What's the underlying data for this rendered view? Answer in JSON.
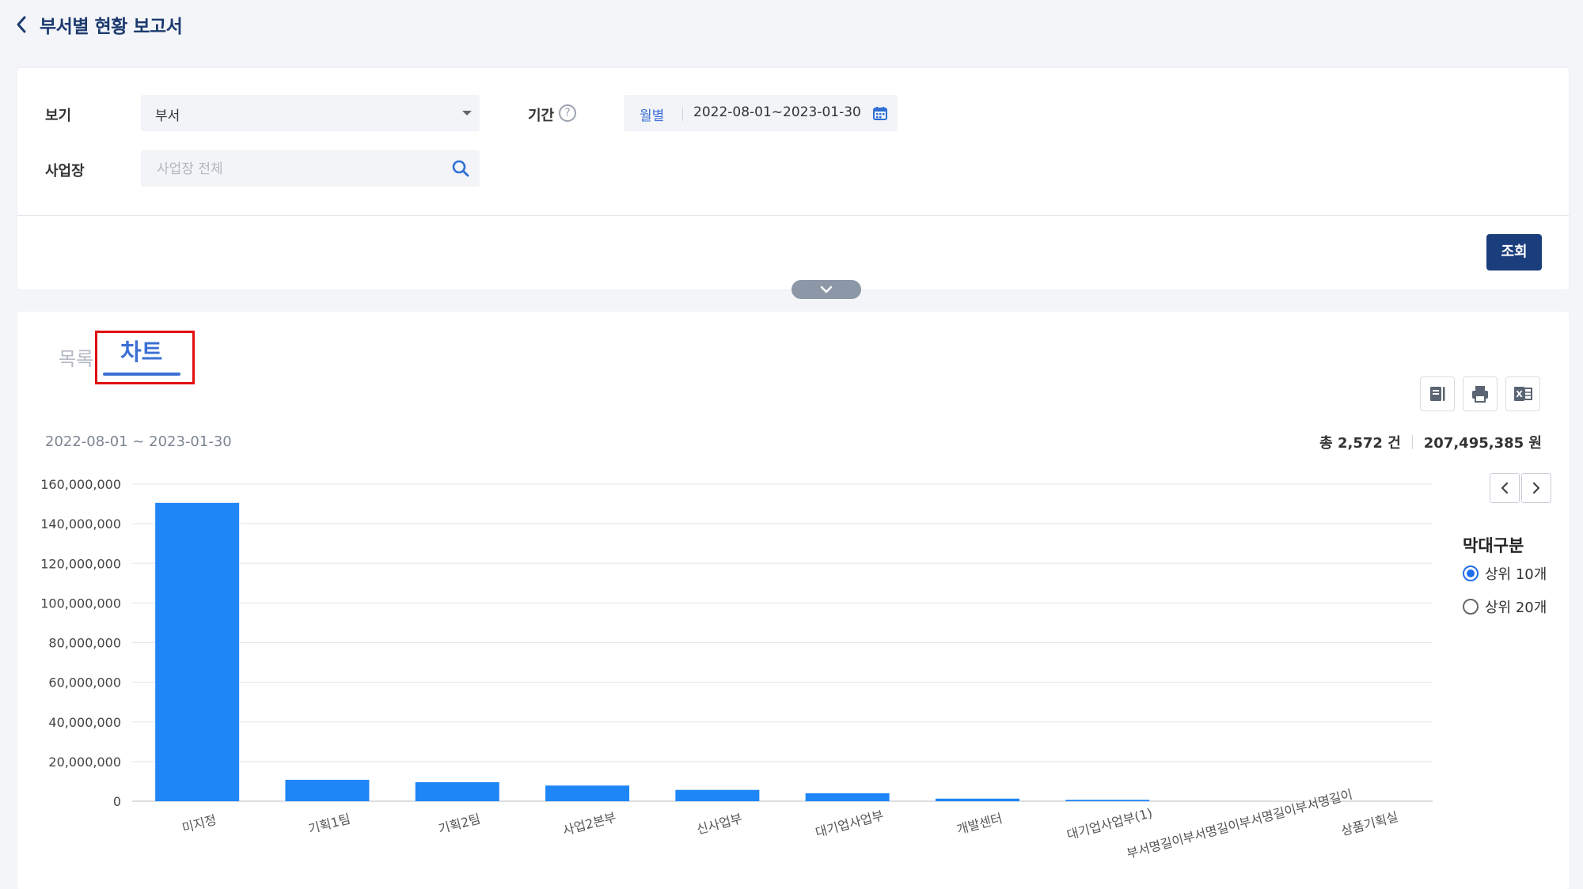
{
  "header": {
    "title": "부서별 현황 보고서",
    "back_icon": "chevron-left-icon"
  },
  "filters": {
    "view_label": "보기",
    "view_value": "부서",
    "site_label": "사업장",
    "site_placeholder": "사업장 전체",
    "period_label": "기간",
    "period_type": "월별",
    "period_value": "2022-08-01~2023-01-30",
    "search_button": "조회"
  },
  "tabs": [
    {
      "label": "목록",
      "active": false
    },
    {
      "label": "차트",
      "active": true
    }
  ],
  "toolbar": {
    "icons": [
      "book-icon",
      "print-icon",
      "excel-icon"
    ]
  },
  "summary": {
    "range": "2022-08-01 ~ 2023-01-30",
    "count": "총 2,572 건",
    "amount": "207,495,385 원"
  },
  "legend": {
    "title": "막대구분",
    "options": [
      {
        "label": "상위 10개",
        "checked": true
      },
      {
        "label": "상위 20개",
        "checked": false
      }
    ]
  },
  "colors": {
    "accent": "#3b6fd4",
    "bar": "#1f86f7",
    "primary_button": "#1a3d7c",
    "highlight_border": "#e01010"
  },
  "chart_data": {
    "type": "bar",
    "categories": [
      "미지정",
      "기획1팀",
      "기획2팀",
      "사업2본부",
      "신사업부",
      "대기업사업부",
      "개발센터",
      "대기업사업부(1)",
      "부서명길이부서명길이부서명길이부서명길이",
      "상품기획실"
    ],
    "values": [
      150500000,
      10800000,
      9600000,
      7900000,
      5700000,
      4000000,
      1300000,
      700000,
      0,
      0
    ],
    "ylim": [
      0,
      160000000
    ],
    "yticks": [
      "0",
      "20,000,000",
      "40,000,000",
      "60,000,000",
      "80,000,000",
      "100,000,000",
      "120,000,000",
      "140,000,000",
      "160,000,000"
    ],
    "grid": true
  }
}
